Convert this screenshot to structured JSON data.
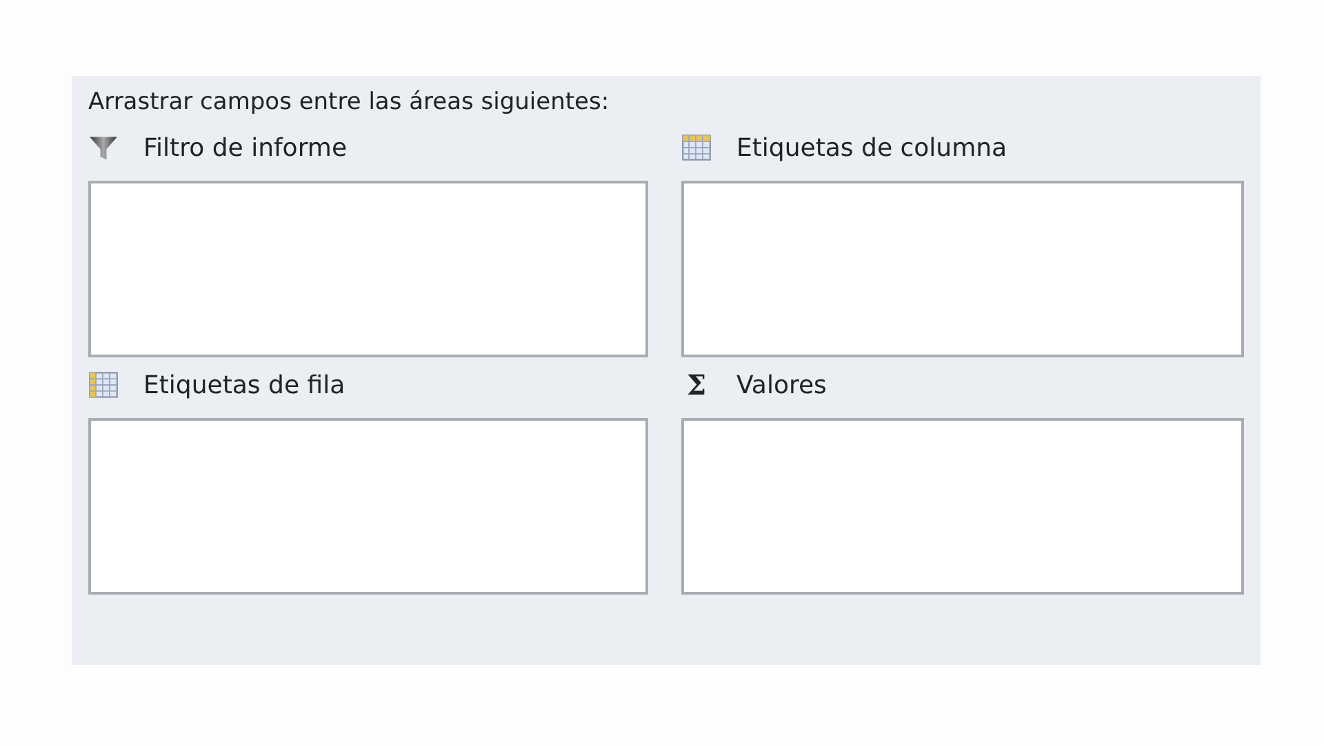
{
  "instruction": "Arrastrar campos entre las áreas siguientes:",
  "areas": [
    {
      "kind": "filter",
      "label": "Filtro de informe"
    },
    {
      "kind": "columns",
      "label": "Etiquetas de columna"
    },
    {
      "kind": "rows",
      "label": "Etiquetas de fila"
    },
    {
      "kind": "values",
      "symbol": "Σ",
      "label": "Valores"
    }
  ]
}
